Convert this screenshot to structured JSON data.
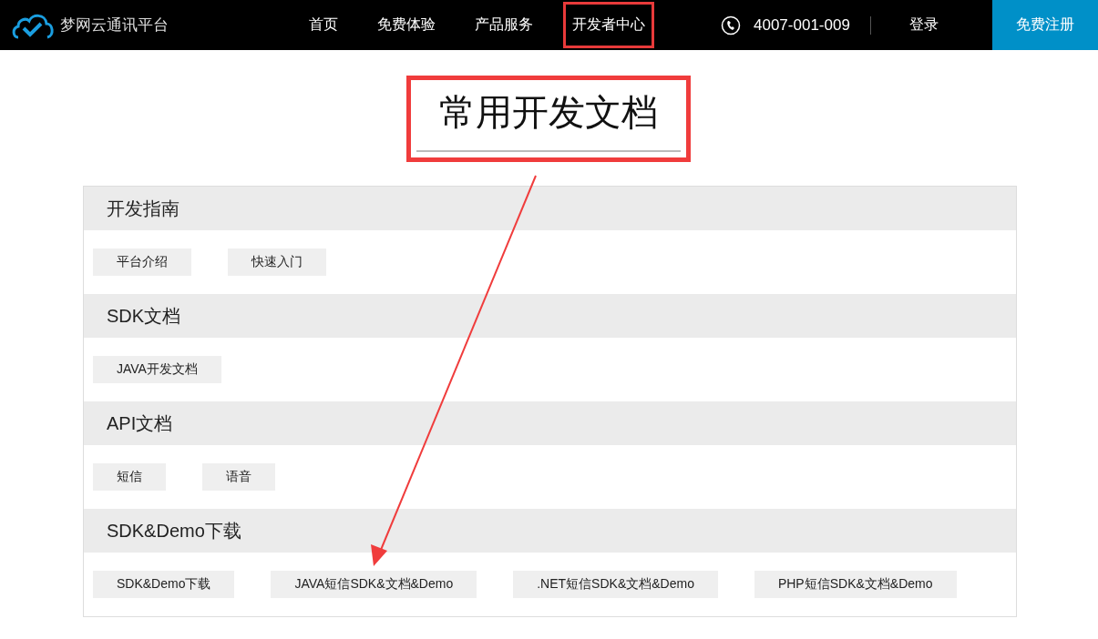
{
  "header": {
    "logo_text": "梦网云通讯平台",
    "nav": [
      {
        "label": "首页",
        "highlighted": false
      },
      {
        "label": "免费体验",
        "highlighted": false
      },
      {
        "label": "产品服务",
        "highlighted": false
      },
      {
        "label": "开发者中心",
        "highlighted": true
      }
    ],
    "phone": "4007-001-009",
    "login": "登录",
    "register": "免费注册"
  },
  "page_title": {
    "text": "常用开发文档",
    "highlighted": true
  },
  "sections": [
    {
      "title": "开发指南",
      "links": [
        "平台介绍",
        "快速入门"
      ]
    },
    {
      "title": "SDK文档",
      "links": [
        "JAVA开发文档"
      ]
    },
    {
      "title": "API文档",
      "links": [
        "短信",
        "语音"
      ]
    },
    {
      "title": "SDK&Demo下载",
      "links": [
        "SDK&Demo下载",
        "JAVA短信SDK&文档&Demo",
        ".NET短信SDK&文档&Demo",
        "PHP短信SDK&文档&Demo"
      ]
    }
  ]
}
